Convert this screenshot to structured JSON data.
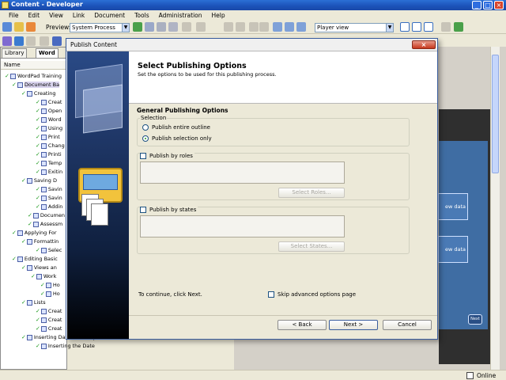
{
  "window": {
    "title": "Content - Developer",
    "min": "_",
    "max": "□",
    "close": "×"
  },
  "menu": [
    "File",
    "Edit",
    "View",
    "Link",
    "Document",
    "Tools",
    "Administration",
    "Help"
  ],
  "toolbar": {
    "preview_label": "Preview:",
    "preview_value": "System Process",
    "player_value": "Player view"
  },
  "left_panel": {
    "tabs": [
      "Library",
      "Word"
    ],
    "column_header": "Name",
    "tree": [
      "WordPad Training",
      "Document Ba",
      "Creating",
      "Creat",
      "Open",
      "Word",
      "Using",
      "Print",
      "Chang",
      "Printi",
      "Temp",
      "Exitin",
      "Saving D",
      "Savin",
      "Savin",
      "Addin",
      "Documen",
      "Assessm",
      "Applying For",
      "Formattin",
      "Selec",
      "Editing Basic",
      "Views an",
      "Work",
      "Ho",
      "Ho",
      "Lists",
      "Creat",
      "Creat",
      "Creat",
      "Inserting Dates and Objects",
      "Inserting the Date"
    ]
  },
  "preview": {
    "box1": "ew data",
    "box2": "ew data",
    "next": "Next"
  },
  "status": {
    "online": "Online"
  },
  "dialog": {
    "title": "Publish Content",
    "close": "×",
    "header_title": "Select Publishing Options",
    "header_subtitle": "Set the options to be used for this publishing process.",
    "section_title": "General Publishing Options",
    "selection_label": "Selection",
    "radio_entire": "Publish entire outline",
    "radio_selection": "Publish selection only",
    "roles_check": "Publish by roles",
    "roles_button": "Select Roles...",
    "states_check": "Publish by states",
    "states_button": "Select States...",
    "continue_text": "To continue, click Next.",
    "skip_check": "Skip advanced options page",
    "back_button": "< Back",
    "next_button": "Next >",
    "cancel_button": "Cancel"
  }
}
